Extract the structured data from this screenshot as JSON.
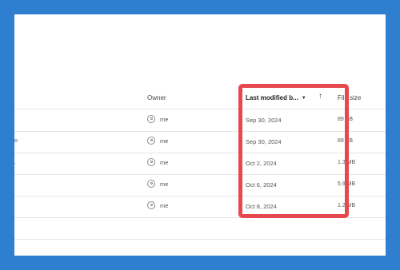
{
  "table": {
    "headers": {
      "owner": "Owner",
      "last_modified": "Last modified b...",
      "file_size": "File size"
    },
    "rows": [
      {
        "name_tail": "",
        "owner": "me",
        "date": "Sep 30, 2024",
        "size": "89 KB"
      },
      {
        "name_tail": "o",
        "owner": "me",
        "date": "Sep 30, 2024",
        "size": "89 KB"
      },
      {
        "name_tail": ".",
        "owner": "me",
        "date": "Oct 2, 2024",
        "size": "1.3 MB"
      },
      {
        "name_tail": "",
        "owner": "me",
        "date": "Oct 6, 2024",
        "size": "5.9 MB"
      },
      {
        "name_tail": "",
        "owner": "me",
        "date": "Oct 8, 2024",
        "size": "1.2 MB"
      }
    ]
  },
  "colors": {
    "background": "#2f7fd0",
    "highlight": "#e5484d"
  },
  "icons": {
    "sort_caret": "caret-down-icon",
    "sort_direction": "arrow-up-icon",
    "owner_avatar": "person-circle-icon"
  }
}
